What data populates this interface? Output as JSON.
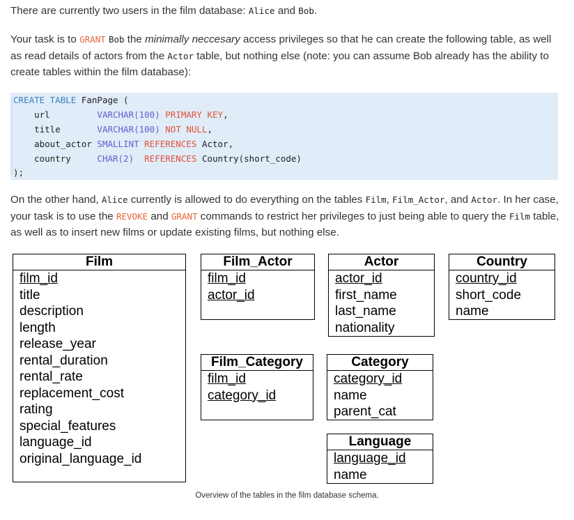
{
  "intro": {
    "p1_a": "There are currently two users in the film database: ",
    "user1": "Alice",
    "p1_and": " and ",
    "user2": "Bob",
    "p1_end": ".",
    "p2_a": "Your task is to ",
    "grant": "GRANT",
    "p2_sp": " ",
    "bob": "Bob",
    "p2_b": " the ",
    "minimally": "minimally neccesary",
    "p2_c": " access privileges so that he can create the following table, as well as read details of actors from the ",
    "actor": "Actor",
    "p2_d": " table, but nothing else (note: you can assume Bob already has the ability to create tables within the film database):"
  },
  "code": {
    "lines": [
      [
        "CREATE TABLE ",
        "FanPage",
        " ("
      ],
      [
        "    url         ",
        "VARCHAR(100) ",
        "PRIMARY KEY",
        ","
      ],
      [
        "    title       ",
        "VARCHAR(100) ",
        "NOT NULL",
        ","
      ],
      [
        "    about_actor ",
        "SMALLINT ",
        "REFERENCES ",
        "Actor,"
      ],
      [
        "    country     ",
        "CHAR(2)  ",
        "REFERENCES ",
        "Country(short_code)"
      ],
      [
        ");"
      ]
    ]
  },
  "para3": {
    "a": "On the other hand, ",
    "alice": "Alice",
    "b": " currently is allowed to do everything on the tables ",
    "film": "Film",
    "c": ", ",
    "film_actor": "Film_Actor",
    "d": ", and ",
    "actor": "Actor",
    "e": ". In her case, your task is to use the ",
    "revoke": "REVOKE",
    "f": " and ",
    "grant": "GRANT",
    "g": " commands to restrict her privileges to just being able to query the ",
    "film2": "Film",
    "h": " table, as well as to insert new films or update existing films, but nothing else."
  },
  "diagram": {
    "tables": [
      {
        "id": "film",
        "name": "Film",
        "pk": [
          "film_id"
        ],
        "fields": [
          "title",
          "description",
          "length",
          "release_year",
          "rental_duration",
          "rental_rate",
          "replacement_cost",
          "rating",
          "special_features",
          "language_id",
          "original_language_id"
        ]
      },
      {
        "id": "film_actor",
        "name": "Film_Actor",
        "pk": [
          "film_id",
          "actor_id"
        ],
        "fields": []
      },
      {
        "id": "actor",
        "name": "Actor",
        "pk": [
          "actor_id"
        ],
        "fields": [
          "first_name",
          "last_name",
          "nationality"
        ]
      },
      {
        "id": "country",
        "name": "Country",
        "pk": [
          "country_id"
        ],
        "fields": [
          "short_code",
          "name"
        ]
      },
      {
        "id": "film_category",
        "name": "Film_Category",
        "pk": [
          "film_id",
          "category_id"
        ],
        "fields": []
      },
      {
        "id": "category",
        "name": "Category",
        "pk": [
          "category_id"
        ],
        "fields": [
          "name",
          "parent_cat"
        ]
      },
      {
        "id": "language",
        "name": "Language",
        "pk": [
          "language_id"
        ],
        "fields": [
          "name"
        ]
      }
    ],
    "caption": "Overview of the tables in the film database schema."
  }
}
